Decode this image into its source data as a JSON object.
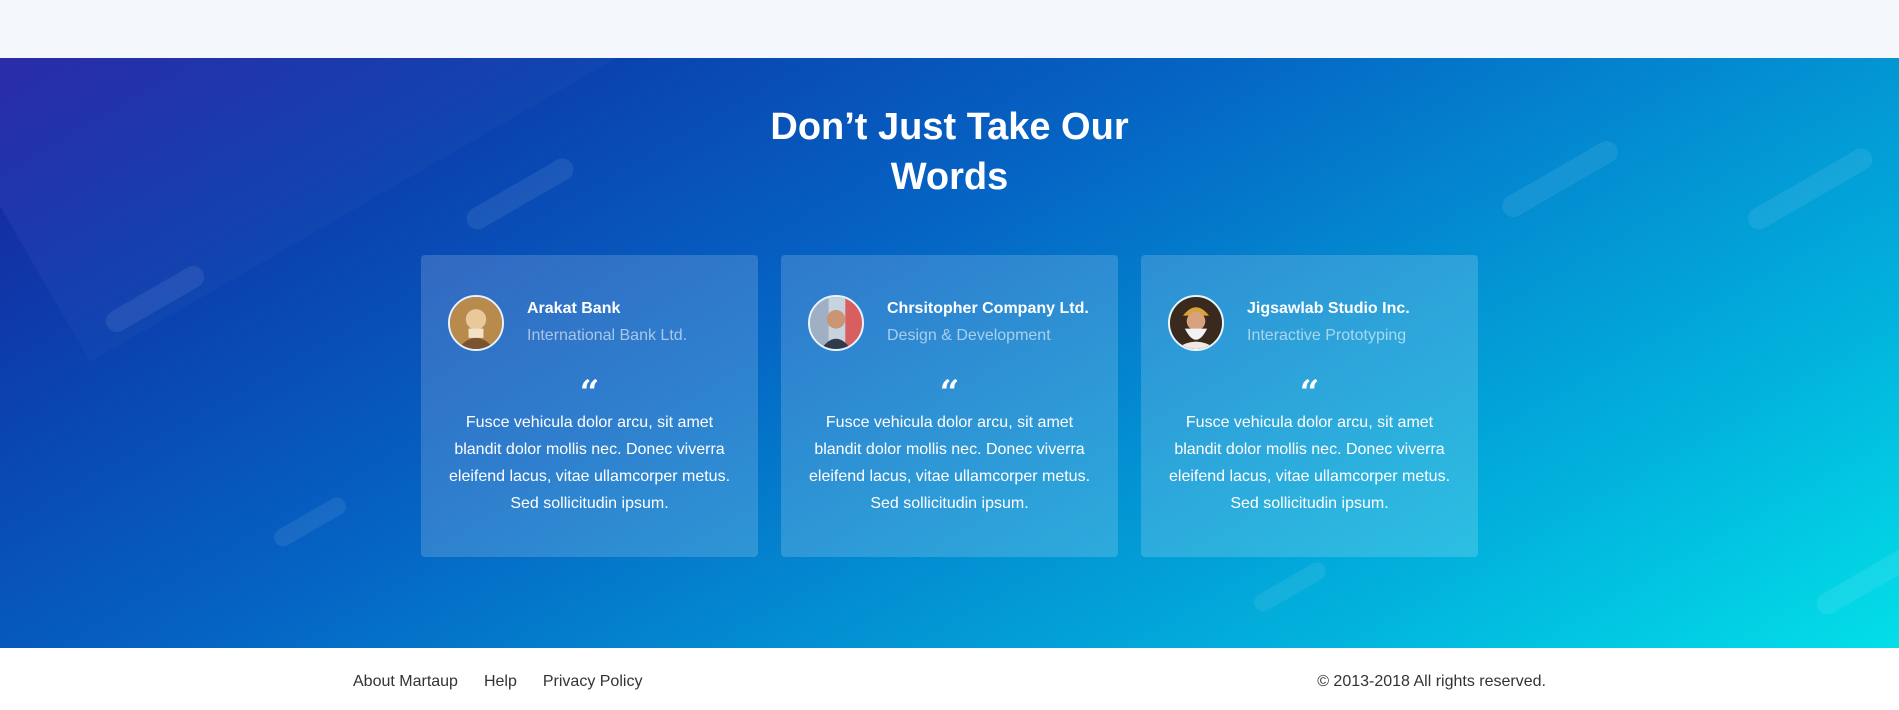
{
  "section": {
    "title_line1": "Don’t Just Take Our",
    "title_line2": "Words"
  },
  "testimonials": [
    {
      "company": "Arakat Bank",
      "role": "International Bank Ltd.",
      "quote_mark": "“",
      "text": "Fusce vehicula dolor arcu, sit amet blandit dolor mollis nec. Donec viverra eleifend lacus, vitae ullamcorper metus. Sed sollicitudin ipsum."
    },
    {
      "company": "Chrsitopher Company Ltd.",
      "role": "Design & Development",
      "quote_mark": "“",
      "text": "Fusce vehicula dolor arcu, sit amet blandit dolor mollis nec. Donec viverra eleifend lacus, vitae ullamcorper metus. Sed sollicitudin ipsum."
    },
    {
      "company": "Jigsawlab Studio Inc.",
      "role": "Interactive Prototyping",
      "quote_mark": "“",
      "text": "Fusce vehicula dolor arcu, sit amet blandit dolor mollis nec. Donec viverra eleifend lacus, vitae ullamcorper metus. Sed sollicitudin ipsum."
    }
  ],
  "footer": {
    "links": [
      "About Martaup",
      "Help",
      "Privacy Policy"
    ],
    "copyright": "© 2013-2018 All rights reserved."
  },
  "colors": {
    "gradient_start": "#1a1f9a",
    "gradient_mid": "#0565c4",
    "gradient_end": "#03dfe8"
  }
}
